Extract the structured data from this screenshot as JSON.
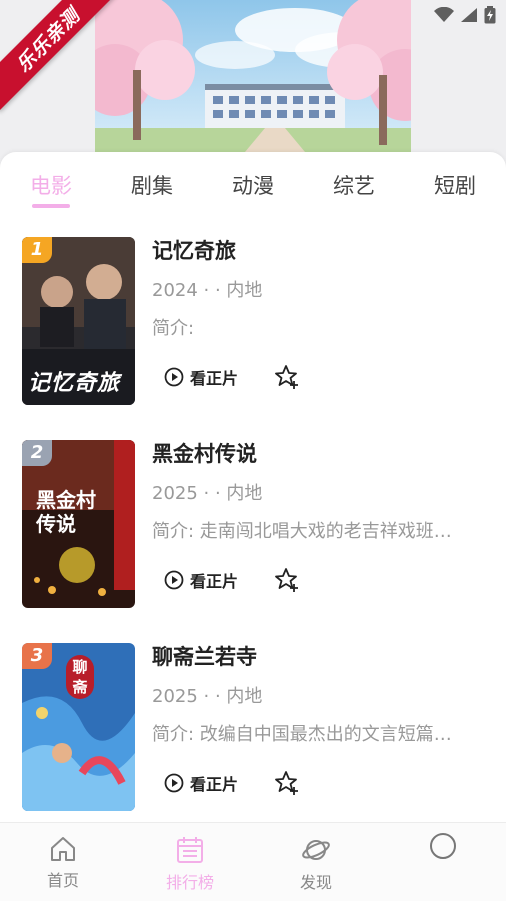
{
  "status_bar": {
    "icons": [
      "wifi-icon",
      "signal-icon",
      "battery-icon"
    ]
  },
  "header": {
    "ribbon_text": "乐乐亲测",
    "ribbon_color": "#c8102e"
  },
  "tabs": [
    {
      "label": "电影",
      "active": true
    },
    {
      "label": "剧集",
      "active": false
    },
    {
      "label": "动漫",
      "active": false
    },
    {
      "label": "综艺",
      "active": false
    },
    {
      "label": "短剧",
      "active": false
    }
  ],
  "accent_color": "#f3aee8",
  "movies": [
    {
      "rank": "1",
      "rank_color": "#f5a623",
      "title": "记忆奇旅",
      "meta": "2024 · · 内地",
      "desc": "简介:",
      "watch_label": "看正片",
      "poster_text": "记忆奇旅"
    },
    {
      "rank": "2",
      "rank_color": "#9aa3b2",
      "title": "黑金村传说",
      "meta": "2025 · · 内地",
      "desc": "简介: 走南闯北唱大戏的老吉祥戏班…",
      "watch_label": "看正片",
      "poster_text": "黑金村传说"
    },
    {
      "rank": "3",
      "rank_color": "#e8734a",
      "title": "聊斋兰若寺",
      "meta": "2025 · · 内地",
      "desc": "简介: 改编自中国最杰出的文言短篇…",
      "watch_label": "看正片",
      "poster_text": "聊斋"
    }
  ],
  "bottom_nav": [
    {
      "label": "首页",
      "icon": "home-icon",
      "active": false
    },
    {
      "label": "排行榜",
      "icon": "ranking-icon",
      "active": true
    },
    {
      "label": "发现",
      "icon": "planet-icon",
      "active": false
    },
    {
      "label": "",
      "icon": "profile-icon",
      "active": false
    }
  ]
}
